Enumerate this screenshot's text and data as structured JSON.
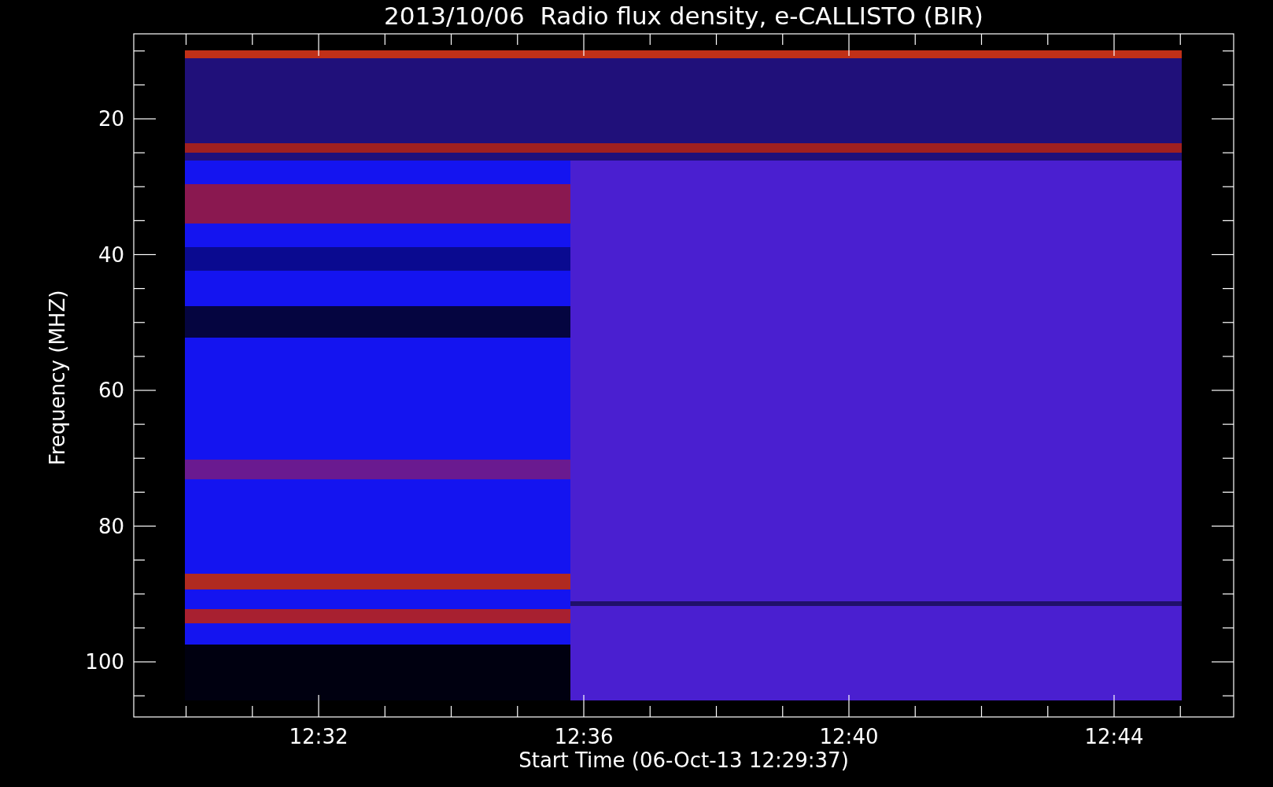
{
  "title": "2013/10/06  Radio flux density, e-CALLISTO (BIR)",
  "y_axis": {
    "label": "Frequency (MHZ)",
    "ticks": [
      "20",
      "40",
      "60",
      "80",
      "100"
    ]
  },
  "x_axis": {
    "label": "Start Time (06-Oct-13 12:29:37)",
    "ticks": [
      "12:32",
      "12:36",
      "12:40",
      "12:44"
    ]
  }
}
